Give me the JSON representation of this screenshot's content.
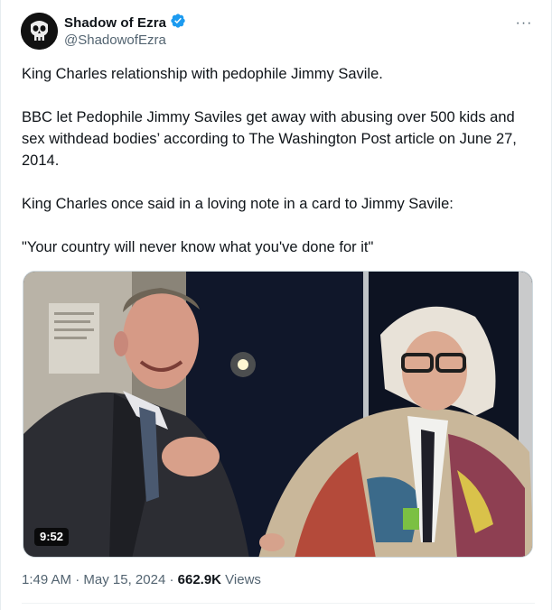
{
  "author": {
    "display_name": "Shadow of Ezra",
    "handle": "@ShadowofEzra",
    "verified_icon": "verified-badge-icon",
    "avatar_icon": "skull-avatar-icon"
  },
  "more_label": "···",
  "tweet": {
    "paragraphs": [
      "King Charles relationship with pedophile Jimmy Savile.",
      "BBC let Pedophile Jimmy Saviles get away with abusing over 500 kids and sex withdead bodies’ according to The Washington Post article on June 27, 2014.",
      "King Charles once said in a loving note in a card to Jimmy Savile:",
      "\"Your country will never know what you've done for it\""
    ]
  },
  "media": {
    "type": "video",
    "duration": "9:52"
  },
  "meta": {
    "time": "1:49 AM",
    "separator": " · ",
    "date": "May 15, 2024",
    "views_count": "662.9K",
    "views_label": " Views"
  },
  "colors": {
    "text": "#0f1419",
    "secondary": "#536471",
    "verified": "#1d9bf0",
    "border": "#cfd9de"
  }
}
